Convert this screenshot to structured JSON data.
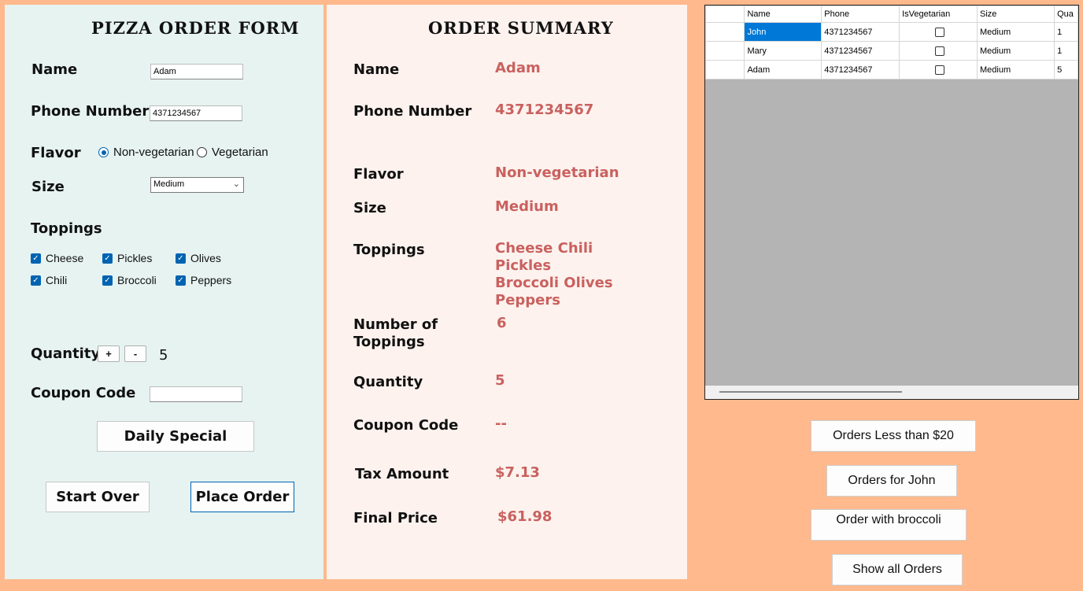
{
  "form": {
    "title": "PIZZA ORDER FORM",
    "name_label": "Name",
    "name_value": "Adam",
    "phone_label": "Phone Number",
    "phone_value": "4371234567",
    "flavor_label": "Flavor",
    "flavor_options": [
      "Non-vegetarian",
      "Vegetarian"
    ],
    "flavor_selected": "Non-vegetarian",
    "size_label": "Size",
    "size_value": "Medium",
    "toppings_label": "Toppings",
    "toppings": [
      {
        "label": "Cheese",
        "checked": true
      },
      {
        "label": "Pickles",
        "checked": true
      },
      {
        "label": "Olives",
        "checked": true
      },
      {
        "label": "Chili",
        "checked": true
      },
      {
        "label": "Broccoli",
        "checked": true
      },
      {
        "label": "Peppers",
        "checked": true
      }
    ],
    "quantity_label": "Quantity",
    "plus_label": "+",
    "minus_label": "-",
    "quantity_value": "5",
    "coupon_label": "Coupon Code",
    "coupon_value": "",
    "daily_special_label": "Daily Special",
    "start_over_label": "Start Over",
    "place_order_label": "Place Order"
  },
  "summary": {
    "title": "ORDER SUMMARY",
    "name_label": "Name",
    "name_value": "Adam",
    "phone_label": "Phone Number",
    "phone_value": "4371234567",
    "flavor_label": "Flavor",
    "flavor_value": "Non-vegetarian",
    "size_label": "Size",
    "size_value": "Medium",
    "toppings_label": "Toppings",
    "toppings_lines": [
      "Cheese Chili",
      "Pickles",
      "Broccoli Olives",
      "Peppers"
    ],
    "num_toppings_label_1": "Number of",
    "num_toppings_label_2": "Toppings",
    "num_toppings_value": "6",
    "quantity_label": "Quantity",
    "quantity_value": "5",
    "coupon_label": "Coupon Code",
    "coupon_value": "--",
    "tax_label": "Tax Amount",
    "tax_value": "$7.13",
    "final_label": "Final Price",
    "final_value": "$61.98"
  },
  "grid": {
    "columns": [
      "Name",
      "Phone",
      "IsVegetarian",
      "Size",
      "Qua"
    ],
    "rows": [
      {
        "name": "John",
        "phone": "4371234567",
        "veg": false,
        "size": "Medium",
        "qty": "1"
      },
      {
        "name": "Mary",
        "phone": "4371234567",
        "veg": false,
        "size": "Medium",
        "qty": "1"
      },
      {
        "name": "Adam",
        "phone": "4371234567",
        "veg": false,
        "size": "Medium",
        "qty": "5"
      }
    ]
  },
  "buttons": {
    "less_than_20": "Orders Less than $20",
    "for_john": "Orders for John",
    "with_broccoli": "Order with broccoli",
    "show_all": "Show all Orders"
  },
  "colors": {
    "background": "#ffb98c",
    "form_panel": "#e6f3f1",
    "summary_panel": "#fdf2ee",
    "summary_value": "#c9615f",
    "accent": "#0063b1"
  }
}
